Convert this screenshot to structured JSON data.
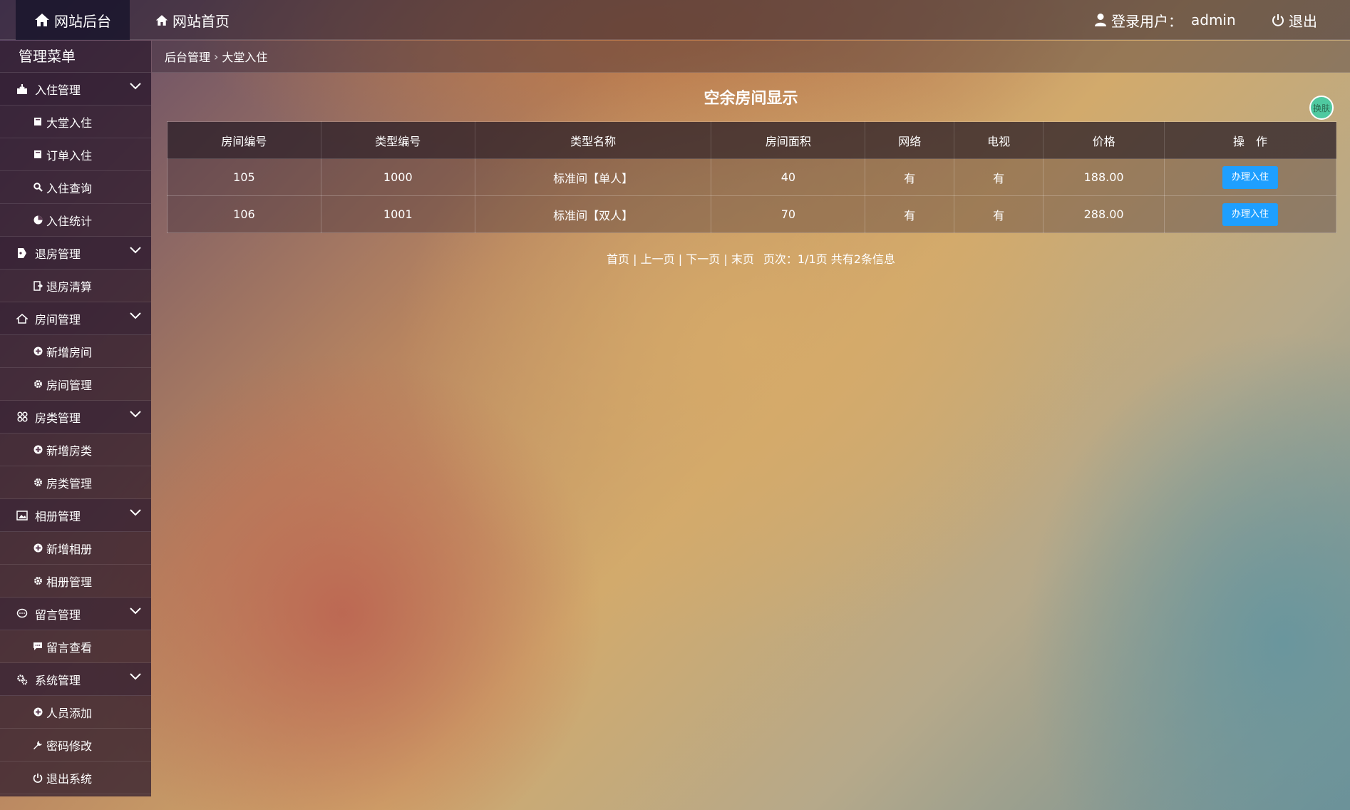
{
  "header": {
    "admin_label": "网站后台",
    "home_label": "网站首页",
    "user_prefix": "登录用户：",
    "username": "admin",
    "logout_label": "退出"
  },
  "sidebar": {
    "title": "管理菜单",
    "groups": [
      {
        "label": "入住管理",
        "icon": "inbox-download-icon",
        "items": [
          {
            "label": "大堂入住",
            "icon": "book-icon"
          },
          {
            "label": "订单入住",
            "icon": "book-icon"
          },
          {
            "label": "入住查询",
            "icon": "search-icon"
          },
          {
            "label": "入住统计",
            "icon": "pie-chart-icon"
          }
        ]
      },
      {
        "label": "退房管理",
        "icon": "tag-icon",
        "items": [
          {
            "label": "退房清算",
            "icon": "sign-out-icon"
          }
        ]
      },
      {
        "label": "房间管理",
        "icon": "home-icon",
        "items": [
          {
            "label": "新增房间",
            "icon": "plus-circle-icon"
          },
          {
            "label": "房间管理",
            "icon": "gear-icon"
          }
        ]
      },
      {
        "label": "房类管理",
        "icon": "grid-icon",
        "items": [
          {
            "label": "新增房类",
            "icon": "plus-circle-icon"
          },
          {
            "label": "房类管理",
            "icon": "gear-icon"
          }
        ]
      },
      {
        "label": "相册管理",
        "icon": "picture-icon",
        "items": [
          {
            "label": "新增相册",
            "icon": "plus-circle-icon"
          },
          {
            "label": "相册管理",
            "icon": "gear-icon"
          }
        ]
      },
      {
        "label": "留言管理",
        "icon": "chat-icon",
        "items": [
          {
            "label": "留言查看",
            "icon": "comment-icon"
          }
        ]
      },
      {
        "label": "系统管理",
        "icon": "cogs-icon",
        "items": [
          {
            "label": "人员添加",
            "icon": "plus-circle-icon"
          },
          {
            "label": "密码修改",
            "icon": "wrench-icon"
          },
          {
            "label": "退出系统",
            "icon": "power-icon"
          }
        ]
      }
    ]
  },
  "breadcrumb": {
    "root": "后台管理",
    "current": "大堂入住"
  },
  "main": {
    "title": "空余房间显示",
    "skin_label": "换肤",
    "columns": [
      "房间编号",
      "类型编号",
      "类型名称",
      "房间面积",
      "网络",
      "电视",
      "价格",
      "操　作"
    ],
    "rows": [
      {
        "room_no": "105",
        "type_no": "1000",
        "type_name": "标准间【单人】",
        "area": "40",
        "network": "有",
        "tv": "有",
        "price": "188.00",
        "action": "办理入住"
      },
      {
        "room_no": "106",
        "type_no": "1001",
        "type_name": "标准间【双人】",
        "area": "70",
        "network": "有",
        "tv": "有",
        "price": "288.00",
        "action": "办理入住"
      }
    ],
    "pager": {
      "first": "首页",
      "prev": "上一页",
      "next": "下一页",
      "last": "末页",
      "page_info": "页次：1/1页",
      "total_info": "共有2条信息"
    }
  },
  "colors": {
    "accent_button": "#1e9fff",
    "skin_button": "#4fc9a0"
  }
}
